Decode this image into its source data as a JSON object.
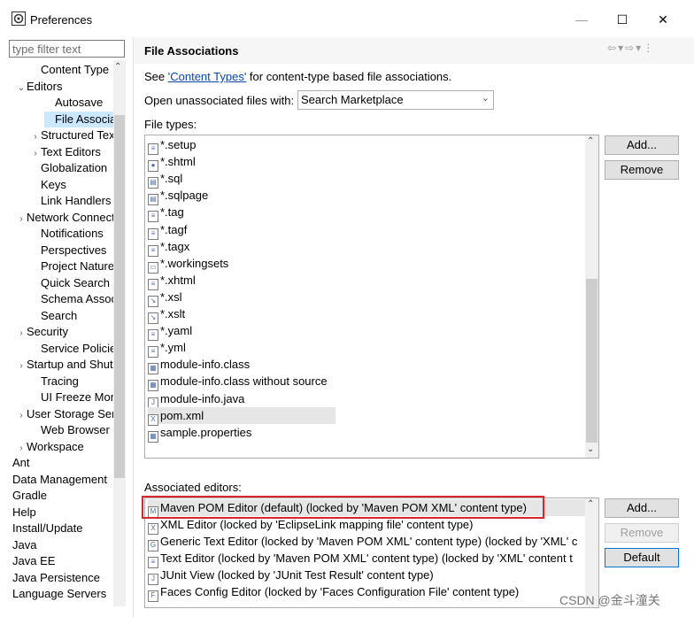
{
  "window": {
    "title": "Preferences",
    "minimize": "—",
    "maximize": "☐",
    "close": "✕"
  },
  "filter": {
    "placeholder": "type filter text"
  },
  "tree": {
    "items": [
      {
        "label": "Content Type",
        "arrow": "",
        "indent": 36,
        "selected": false
      },
      {
        "label": "Editors",
        "arrow": "⌄",
        "indent": 20,
        "selected": false
      },
      {
        "label": "Autosave",
        "arrow": "",
        "indent": 52,
        "selected": false
      },
      {
        "label": "File Associations",
        "arrow": "",
        "indent": 52,
        "selected": true
      },
      {
        "label": "Structured Text Editors",
        "arrow": "›",
        "indent": 36,
        "selected": false
      },
      {
        "label": "Text Editors",
        "arrow": "›",
        "indent": 36,
        "selected": false
      },
      {
        "label": "Globalization",
        "arrow": "",
        "indent": 36,
        "selected": false
      },
      {
        "label": "Keys",
        "arrow": "",
        "indent": 36,
        "selected": false
      },
      {
        "label": "Link Handlers",
        "arrow": "",
        "indent": 36,
        "selected": false
      },
      {
        "label": "Network Connections",
        "arrow": "›",
        "indent": 20,
        "selected": false
      },
      {
        "label": "Notifications",
        "arrow": "",
        "indent": 36,
        "selected": false
      },
      {
        "label": "Perspectives",
        "arrow": "",
        "indent": 36,
        "selected": false
      },
      {
        "label": "Project Natures",
        "arrow": "",
        "indent": 36,
        "selected": false
      },
      {
        "label": "Quick Search",
        "arrow": "",
        "indent": 36,
        "selected": false
      },
      {
        "label": "Schema Associations",
        "arrow": "",
        "indent": 36,
        "selected": false
      },
      {
        "label": "Search",
        "arrow": "",
        "indent": 36,
        "selected": false
      },
      {
        "label": "Security",
        "arrow": "›",
        "indent": 20,
        "selected": false
      },
      {
        "label": "Service Policies",
        "arrow": "",
        "indent": 36,
        "selected": false
      },
      {
        "label": "Startup and Shutdown",
        "arrow": "›",
        "indent": 20,
        "selected": false
      },
      {
        "label": "Tracing",
        "arrow": "",
        "indent": 36,
        "selected": false
      },
      {
        "label": "UI Freeze Monitoring",
        "arrow": "",
        "indent": 36,
        "selected": false
      },
      {
        "label": "User Storage Service",
        "arrow": "›",
        "indent": 20,
        "selected": false
      },
      {
        "label": "Web Browser",
        "arrow": "",
        "indent": 36,
        "selected": false
      },
      {
        "label": "Workspace",
        "arrow": "›",
        "indent": 20,
        "selected": false
      },
      {
        "label": "Ant",
        "arrow": "›",
        "indent": 4,
        "selected": false
      },
      {
        "label": "Data Management",
        "arrow": "›",
        "indent": 4,
        "selected": false
      },
      {
        "label": "Gradle",
        "arrow": "›",
        "indent": 4,
        "selected": false
      },
      {
        "label": "Help",
        "arrow": "›",
        "indent": 4,
        "selected": false
      },
      {
        "label": "Install/Update",
        "arrow": "›",
        "indent": 4,
        "selected": false
      },
      {
        "label": "Java",
        "arrow": "›",
        "indent": 4,
        "selected": false
      },
      {
        "label": "Java EE",
        "arrow": "›",
        "indent": 4,
        "selected": false
      },
      {
        "label": "Java Persistence",
        "arrow": "›",
        "indent": 4,
        "selected": false
      },
      {
        "label": "Language Servers",
        "arrow": "›",
        "indent": 4,
        "selected": false
      }
    ]
  },
  "page": {
    "title": "File Associations",
    "see_prefix": "See ",
    "see_link": "'Content Types'",
    "see_suffix": " for content-type based file associations.",
    "open_label": "Open unassociated files with:",
    "open_value": "Search Marketplace",
    "filetypes_label": "File types:",
    "file_types": [
      {
        "label": "*.setup",
        "icon": "≡",
        "selected": false
      },
      {
        "label": "*.shtml",
        "icon": "●",
        "selected": false
      },
      {
        "label": "*.sql",
        "icon": "▤",
        "selected": false
      },
      {
        "label": "*.sqlpage",
        "icon": "▤",
        "selected": false
      },
      {
        "label": "*.tag",
        "icon": "≡",
        "selected": false
      },
      {
        "label": "*.tagf",
        "icon": "≡",
        "selected": false
      },
      {
        "label": "*.tagx",
        "icon": "≡",
        "selected": false
      },
      {
        "label": "*.workingsets",
        "icon": "▭",
        "selected": false
      },
      {
        "label": "*.xhtml",
        "icon": "≡",
        "selected": false
      },
      {
        "label": "*.xsl",
        "icon": "↘",
        "selected": false
      },
      {
        "label": "*.xslt",
        "icon": "↘",
        "selected": false
      },
      {
        "label": "*.yaml",
        "icon": "≡",
        "selected": false
      },
      {
        "label": "*.yml",
        "icon": "≡",
        "selected": false
      },
      {
        "label": "module-info.class",
        "icon": "▦",
        "selected": false
      },
      {
        "label": "module-info.class without source",
        "icon": "▦",
        "selected": false
      },
      {
        "label": "module-info.java",
        "icon": "J",
        "selected": false
      },
      {
        "label": "pom.xml",
        "icon": "X",
        "selected": true
      },
      {
        "label": "sample.properties",
        "icon": "▦",
        "selected": false
      }
    ],
    "add_label": "Add...",
    "remove_label": "Remove",
    "assoc_label": "Associated editors:",
    "editors": [
      {
        "label": "Maven POM Editor (default) (locked by 'Maven POM XML' content type)",
        "icon": "M",
        "selected": true
      },
      {
        "label": "XML Editor (locked by 'EclipseLink mapping file' content type)",
        "icon": "X",
        "selected": false
      },
      {
        "label": "Generic Text Editor (locked by 'Maven POM XML' content type) (locked by 'XML' c",
        "icon": "G",
        "selected": false
      },
      {
        "label": "Text Editor (locked by 'Maven POM XML' content type) (locked by 'XML' content t",
        "icon": "≡",
        "selected": false
      },
      {
        "label": "JUnit View (locked by 'JUnit Test Result' content type)",
        "icon": "J",
        "selected": false
      },
      {
        "label": "Faces Config Editor (locked by 'Faces Configuration File' content type)",
        "icon": "F",
        "selected": false
      }
    ],
    "ed_add_label": "Add...",
    "ed_remove_label": "Remove",
    "ed_default_label": "Default"
  },
  "watermark": "CSDN @金斗潼关",
  "colors": {
    "selection": "#cce8ff",
    "highlight_box": "#d9262c",
    "link": "#0645ad",
    "default_button_border": "#0078d7"
  }
}
